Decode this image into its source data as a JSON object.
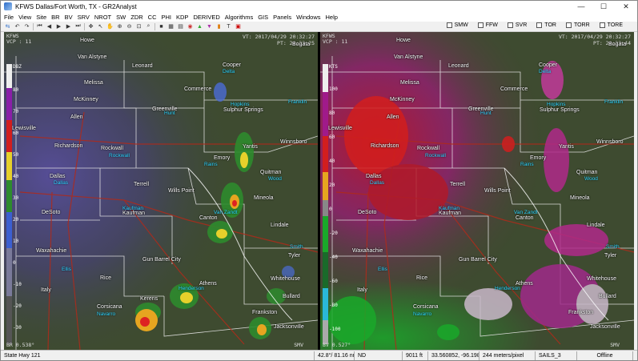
{
  "window": {
    "title": "KFWS Dallas/Fort Worth, TX - GR2Analyst"
  },
  "menu": [
    "File",
    "View",
    "Site",
    "BR",
    "BV",
    "SRV",
    "NROT",
    "SW",
    "ZDR",
    "CC",
    "PHI",
    "KDP",
    "DERIVED",
    "Algorithms",
    "GIS",
    "Panels",
    "Windows",
    "Help"
  ],
  "warnings": [
    "SMW",
    "FFW",
    "SVR",
    "TOR",
    "TORR",
    "TORE"
  ],
  "left_panel": {
    "site": "KFWS",
    "vcp": "VCP : 11",
    "vt": "VT: 2017/04/29  20:32:27",
    "pt": "PT:  20:32:25",
    "product": "BR 0.538°",
    "smv": "SMV",
    "colorbar_top": "DBZ",
    "colorbar_labels": [
      "80",
      "70",
      "60",
      "50",
      "40",
      "30",
      "20",
      "10",
      "0",
      "-10",
      "-20",
      "-30"
    ]
  },
  "right_panel": {
    "site": "KFWS",
    "vcp": "VCP : 11",
    "vt": "VT: 2017/04/29  20:32:27",
    "pt": "PT:  20:32:44",
    "product": "BV 0.527°",
    "smv": "SMV",
    "colorbar_top": "KTS",
    "colorbar_labels": [
      "100",
      "80",
      "60",
      "40",
      "20",
      "0",
      "-20",
      "-40",
      "-60",
      "-80",
      "-100"
    ]
  },
  "cities": [
    "Howe",
    "Van Alstyne",
    "Leonard",
    "Cooper",
    "Melissa",
    "Commerce",
    "McKinney",
    "Greenville",
    "Sulphur Springs",
    "Allen",
    "Lewisville",
    "Richardson",
    "Rockwall",
    "Emory",
    "Yantis",
    "Winnsboro",
    "Dallas",
    "Terrell",
    "Wills Point",
    "Quitman",
    "Mineola",
    "DeSoto",
    "Kaufman",
    "Canton",
    "Lindale",
    "Waxahachie",
    "Gun Barrel City",
    "Tyler",
    "Rice",
    "Athens",
    "Whitehouse",
    "Italy",
    "Corsicana",
    "Kerens",
    "Bullard",
    "Frankston",
    "Jacksonville",
    "Bogata"
  ],
  "counties": [
    "Delta",
    "Hopkins",
    "Franklin",
    "Hunt",
    "Rockwall",
    "Rains",
    "Wood",
    "Dallas",
    "Van Zandt",
    "Kaufman",
    "Smith",
    "Ellis",
    "Henderson",
    "Navarro"
  ],
  "status": {
    "location": "State Hwy 121",
    "range": "42.8°/ 81.16 nm",
    "nd": "ND",
    "elev": "9011 ft",
    "latlon": "33.560852, -96.198807",
    "scale": "244 meters/pixel",
    "mode": "SAILS_3",
    "connection": "Offline"
  }
}
